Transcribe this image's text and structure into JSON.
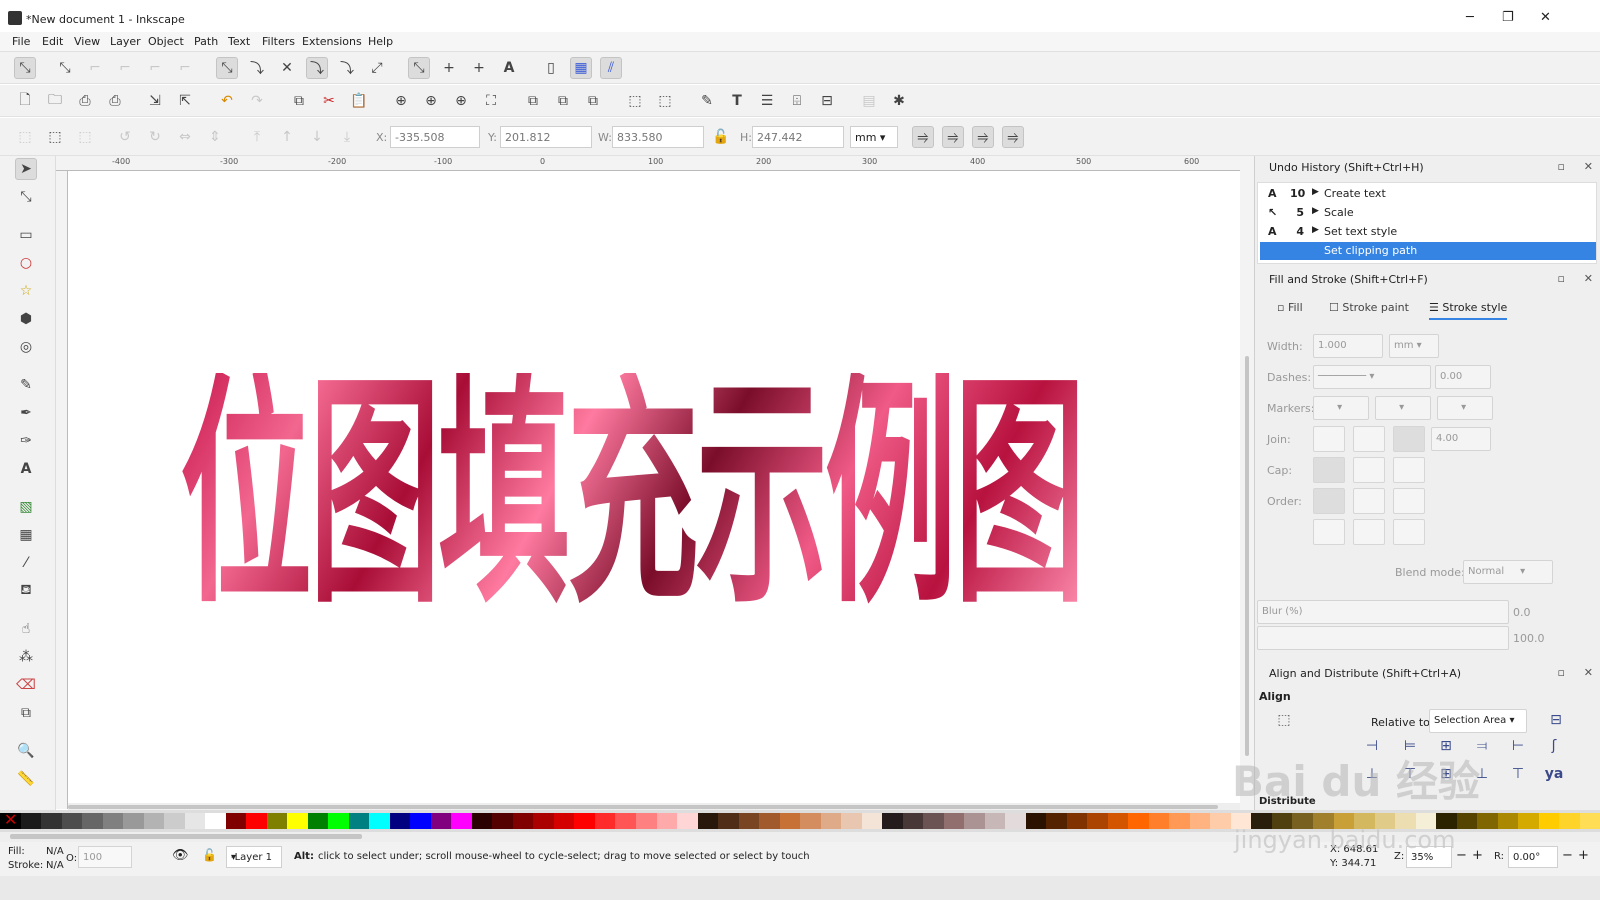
{
  "window": {
    "title": "*New document 1 - Inkscape",
    "minimize": "─",
    "restore": "❐",
    "close": "✕"
  },
  "menu": [
    "File",
    "Edit",
    "View",
    "Layer",
    "Object",
    "Path",
    "Text",
    "Filters",
    "Extensions",
    "Help"
  ],
  "selectbar": {
    "x_label": "X:",
    "x_value": "-335.508",
    "y_label": "Y:",
    "y_value": "201.812",
    "w_label": "W:",
    "w_value": "833.580",
    "h_label": "H:",
    "h_value": "247.442",
    "unit": "mm"
  },
  "rulers": [
    "-400",
    "-300",
    "-200",
    "-100",
    "0",
    "100",
    "200",
    "300",
    "400",
    "500",
    "600"
  ],
  "canvas": {
    "text": "位图填充示例图"
  },
  "undo": {
    "title": "Undo History (Shift+Ctrl+H)",
    "items": [
      {
        "icon": "A",
        "count": "10",
        "label": "Create text"
      },
      {
        "icon": "↖",
        "count": "5",
        "label": "Scale"
      },
      {
        "icon": "A",
        "count": "4",
        "label": "Set text style"
      },
      {
        "icon": "",
        "count": "",
        "label": "Set clipping path"
      }
    ]
  },
  "fill_stroke": {
    "title": "Fill and Stroke (Shift+Ctrl+F)",
    "tabs": [
      "Fill",
      "Stroke paint",
      "Stroke style"
    ],
    "width_label": "Width:",
    "width_value": "1.000",
    "width_unit": "mm",
    "dashes_label": "Dashes:",
    "dashes_value": "0.00",
    "markers_label": "Markers:",
    "join_label": "Join:",
    "join_value": "4.00",
    "cap_label": "Cap:",
    "order_label": "Order:",
    "blend_label": "Blend mode:",
    "blend_value": "Normal",
    "blur_label": "Blur (%)",
    "blur_value": "0.0",
    "opacity_value": "100.0"
  },
  "align": {
    "title": "Align and Distribute (Shift+Ctrl+A)",
    "section": "Align",
    "relative_label": "Relative to:",
    "relative_value": "Selection Area",
    "distribute": "Distribute"
  },
  "status": {
    "fill_label": "Fill:",
    "fill_value": "N/A",
    "stroke_label": "Stroke:",
    "stroke_value": "N/A",
    "opacity_label": "O:",
    "opacity_value": "100",
    "layer": "-Layer 1",
    "message_bold": "Alt:",
    "message": "click to select under; scroll mouse-wheel to cycle-select; drag to move selected or select by touch",
    "x": "X: 648.61",
    "y": "Y: 344.71",
    "zoom_label": "Z:",
    "zoom": "35%",
    "rotate_label": "R:",
    "rotate": "0.00°"
  },
  "watermark": {
    "logo": "Bai du 经验",
    "url": "jingyan.baidu.com"
  },
  "palette": [
    "#000000",
    "#1a1a1a",
    "#333333",
    "#4d4d4d",
    "#666666",
    "#808080",
    "#999999",
    "#b3b3b3",
    "#cccccc",
    "#e6e6e6",
    "#ffffff",
    "#800000",
    "#ff0000",
    "#808000",
    "#ffff00",
    "#008000",
    "#00ff00",
    "#008080",
    "#00ffff",
    "#000080",
    "#0000ff",
    "#800080",
    "#ff00ff",
    "#2b0000",
    "#550000",
    "#800000",
    "#aa0000",
    "#d40000",
    "#ff0000",
    "#ff2a2a",
    "#ff5555",
    "#ff8080",
    "#ffaaaa",
    "#ffd5d5",
    "#28170b",
    "#502d16",
    "#784421",
    "#a05a2c",
    "#c87137",
    "#d38d5f",
    "#deaa87",
    "#e9c6af",
    "#f4e3d7",
    "#241c1c",
    "#483737",
    "#6c5353",
    "#916f6f",
    "#ac9393",
    "#c8b7b7",
    "#e3dbdb",
    "#2b1100",
    "#552200",
    "#803300",
    "#aa4400",
    "#d45500",
    "#ff6600",
    "#ff7f2a",
    "#ff9955",
    "#ffb380",
    "#ffccaa",
    "#ffe6d5",
    "#281e0b",
    "#50400f",
    "#786020",
    "#a0802c",
    "#c8a037",
    "#d4b860",
    "#e0cc88",
    "#ecdeb0",
    "#f6efd8",
    "#2b2200",
    "#554400",
    "#806600",
    "#aa8800",
    "#d4aa00",
    "#ffcc00",
    "#ffd42a",
    "#ffdd55"
  ]
}
